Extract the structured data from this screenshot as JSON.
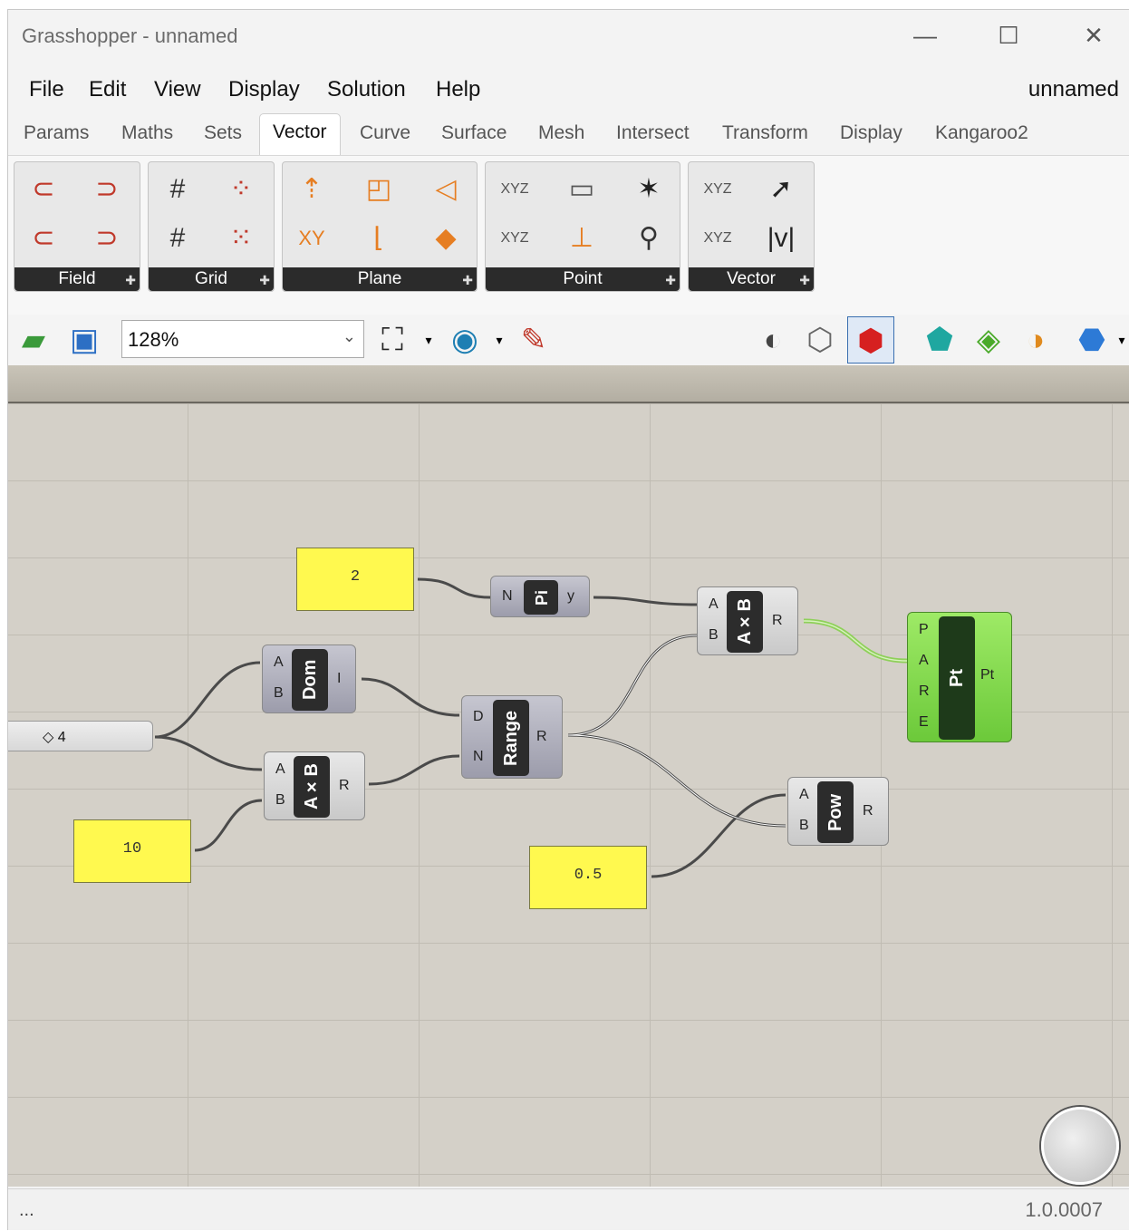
{
  "window": {
    "title": "Grasshopper - unnamed",
    "document_name": "unnamed"
  },
  "menu": [
    "File",
    "Edit",
    "View",
    "Display",
    "Solution",
    "Help"
  ],
  "tabs": [
    "Params",
    "Maths",
    "Sets",
    "Vector",
    "Curve",
    "Surface",
    "Mesh",
    "Intersect",
    "Transform",
    "Display",
    "Kangaroo2"
  ],
  "active_tab": "Vector",
  "ribbon_groups": [
    "Field",
    "Grid",
    "Plane",
    "Point",
    "Vector"
  ],
  "toolbar": {
    "zoom": "128%"
  },
  "canvas": {
    "panels": [
      "2",
      "10",
      "0.5"
    ],
    "slider_value": "◇ 4",
    "pi": {
      "nickname": "Pi",
      "inputs": [
        "N"
      ],
      "outputs": [
        "y"
      ]
    },
    "multiply_top": {
      "nickname": "A×B",
      "inputs": [
        "A",
        "B"
      ],
      "outputs": [
        "R"
      ]
    },
    "domain": {
      "nickname": "Dom",
      "inputs": [
        "A",
        "B"
      ],
      "outputs": [
        "I"
      ]
    },
    "multiply_bottom": {
      "nickname": "A×B",
      "inputs": [
        "A",
        "B"
      ],
      "outputs": [
        "R"
      ]
    },
    "range": {
      "nickname": "Range",
      "inputs": [
        "D",
        "N"
      ],
      "outputs": [
        "R"
      ]
    },
    "power": {
      "nickname": "Pow",
      "inputs": [
        "A",
        "B"
      ],
      "outputs": [
        "R"
      ]
    },
    "polar_point": {
      "nickname": "Pt",
      "inputs": [
        "P",
        "A",
        "R",
        "E"
      ],
      "outputs": [
        "Pt"
      ]
    }
  },
  "status": {
    "left": "...",
    "version": "1.0.0007"
  },
  "colors": {
    "canvas": "#d4d0c8",
    "panel": "#fff94f",
    "wire": "#4a4a4a",
    "selected_wire": "#8fd05a"
  }
}
